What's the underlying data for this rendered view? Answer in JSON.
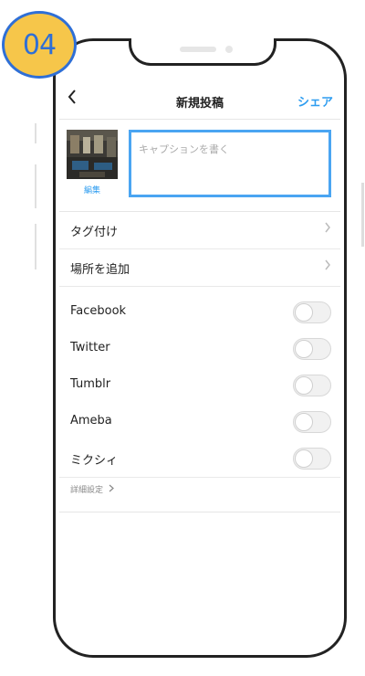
{
  "step_badge": "04",
  "header": {
    "back_icon": "chevron-left-icon",
    "title": "新規投稿",
    "share": "シェア"
  },
  "post": {
    "edit_label": "編集",
    "caption_placeholder": "キャプションを書く"
  },
  "menu": {
    "tag": "タグ付け",
    "location": "場所を追加"
  },
  "share_targets": [
    {
      "label": "Facebook",
      "on": false
    },
    {
      "label": "Twitter",
      "on": false
    },
    {
      "label": "Tumblr",
      "on": false
    },
    {
      "label": "Ameba",
      "on": false
    },
    {
      "label": "ミクシィ",
      "on": false
    }
  ],
  "advanced_settings": "詳細設定",
  "colors": {
    "accent": "#2e9df0",
    "badge_fill": "#f6c64a",
    "badge_border": "#2f6fd6"
  }
}
